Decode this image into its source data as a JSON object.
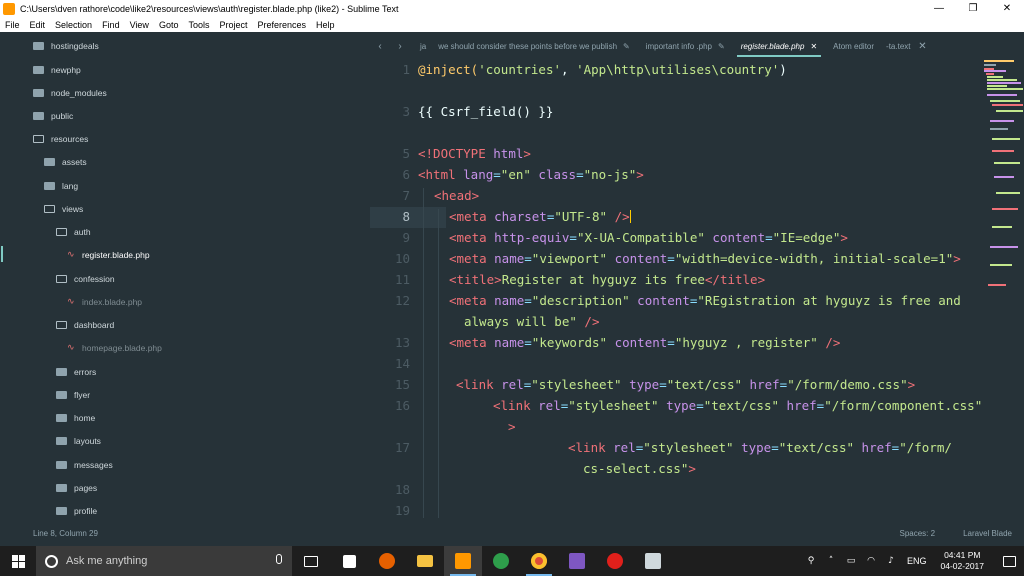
{
  "window": {
    "title": "C:\\Users\\dven rathore\\code\\like2\\resources\\views\\auth\\register.blade.php (like2) - Sublime Text",
    "minimize_label": "—",
    "maximize_label": "❐",
    "close_label": "✕"
  },
  "menu": [
    "File",
    "Edit",
    "Selection",
    "Find",
    "View",
    "Goto",
    "Tools",
    "Project",
    "Preferences",
    "Help"
  ],
  "sidebar": {
    "items": [
      {
        "label": "hostingdeals",
        "type": "folder",
        "depth": 0
      },
      {
        "label": "newphp",
        "type": "folder",
        "depth": 0
      },
      {
        "label": "node_modules",
        "type": "folder",
        "depth": 0
      },
      {
        "label": "public",
        "type": "folder",
        "depth": 0
      },
      {
        "label": "resources",
        "type": "folder-open",
        "depth": 0
      },
      {
        "label": "assets",
        "type": "folder",
        "depth": 1
      },
      {
        "label": "lang",
        "type": "folder",
        "depth": 1
      },
      {
        "label": "views",
        "type": "folder-open",
        "depth": 1
      },
      {
        "label": "auth",
        "type": "folder-open",
        "depth": 2
      },
      {
        "label": "register.blade.php",
        "type": "file-active",
        "depth": 3
      },
      {
        "label": "confession",
        "type": "folder-open",
        "depth": 2
      },
      {
        "label": "index.blade.php",
        "type": "file",
        "depth": 3
      },
      {
        "label": "dashboard",
        "type": "folder-open",
        "depth": 2
      },
      {
        "label": "homepage.blade.php",
        "type": "file",
        "depth": 3
      },
      {
        "label": "errors",
        "type": "folder",
        "depth": 2
      },
      {
        "label": "flyer",
        "type": "folder",
        "depth": 2
      },
      {
        "label": "home",
        "type": "folder",
        "depth": 2
      },
      {
        "label": "layouts",
        "type": "folder",
        "depth": 2
      },
      {
        "label": "messages",
        "type": "folder",
        "depth": 2
      },
      {
        "label": "pages",
        "type": "folder",
        "depth": 2
      },
      {
        "label": "profile",
        "type": "folder",
        "depth": 2
      }
    ]
  },
  "tabs": {
    "prev_label": "‹",
    "next_label": "›",
    "items": [
      {
        "label": "ja",
        "active": false,
        "pencil": false
      },
      {
        "label": "we should consider these points before we publish",
        "active": false,
        "pencil": true
      },
      {
        "label": "important info .php",
        "active": false,
        "pencil": true
      },
      {
        "label": "register.blade.php",
        "active": true,
        "pencil": false,
        "close": "✕"
      },
      {
        "label": "Atom editor",
        "active": false,
        "pencil": false
      },
      {
        "label": "-ta.text",
        "active": false,
        "pencil": false
      }
    ],
    "more_label": "✕"
  },
  "editor": {
    "gutter": [
      "1",
      "",
      "3",
      "",
      "5",
      "6",
      "7",
      "8",
      "9",
      "10",
      "11",
      "12",
      "",
      "13",
      "14",
      "15",
      "16",
      "",
      "17",
      "",
      "18",
      "19"
    ],
    "current_line": "8",
    "code": {
      "l1a": "@inject(",
      "l1b": "'countries'",
      "l1c": ", ",
      "l1d": "'App\\http\\utilises\\country'",
      "l1e": ")",
      "l3": "{{ Csrf_field() }}",
      "l5a": "<!DOCTYPE ",
      "l5b": "html",
      "l5c": ">",
      "l6a": "<html ",
      "l6b": "lang",
      "l6c": "=",
      "l6d": "\"en\"",
      "l6e": " class",
      "l6f": "=",
      "l6g": "\"no-js\"",
      "l6h": ">",
      "l7": "<head>",
      "l8a": "<meta ",
      "l8b": "charset",
      "l8c": "=",
      "l8d": "\"UTF-8\"",
      "l8e": " />",
      "l9a": "<meta ",
      "l9b": "http-equiv",
      "l9c": "=",
      "l9d": "\"X-UA-Compatible\"",
      "l9e": " content",
      "l9f": "=",
      "l9g": "\"IE=edge\"",
      "l9h": ">",
      "l10a": "<meta ",
      "l10b": "name",
      "l10c": "=",
      "l10d": "\"viewport\"",
      "l10e": " content",
      "l10f": "=",
      "l10g": "\"width=device-width, initial-scale=1\"",
      "l10h": ">",
      "l11a": "<title>",
      "l11b": "Register at hyguyz its free",
      "l11c": "</title>",
      "l12a": "<meta ",
      "l12b": "name",
      "l12c": "=",
      "l12d": "\"description\"",
      "l12e": " content",
      "l12f": "=",
      "l12g": "\"REgistration at hyguyz is free and",
      "l12w": "always will be\"",
      "l12x": " />",
      "l13a": "<meta ",
      "l13b": "name",
      "l13c": "=",
      "l13d": "\"keywords\"",
      "l13e": " content",
      "l13f": "=",
      "l13g": "\"hyguyz , register\"",
      "l13h": " />",
      "l15a": "<link ",
      "l15b": "rel",
      "l15c": "=",
      "l15d": "\"stylesheet\"",
      "l15e": " type",
      "l15f": "=",
      "l15g": "\"text/css\"",
      "l15h": " href",
      "l15i": "=",
      "l15j": "\"/form/demo.css\"",
      "l15k": ">",
      "l16a": "<link ",
      "l16b": "rel",
      "l16c": "=",
      "l16d": "\"stylesheet\"",
      "l16e": " type",
      "l16f": "=",
      "l16g": "\"text/css\"",
      "l16h": " href",
      "l16i": "=",
      "l16j": "\"/form/component.css\"",
      "l16w": ">",
      "l17a": "<link ",
      "l17b": "rel",
      "l17c": "=",
      "l17d": "\"stylesheet\"",
      "l17e": " type",
      "l17f": "=",
      "l17g": "\"text/css\"",
      "l17h": " href",
      "l17i": "=",
      "l17j": "\"/form/",
      "l17w": "cs-select.css\"",
      "l17x": ">"
    }
  },
  "statusbar": {
    "position": "Line 8, Column 29",
    "spaces": "Spaces: 2",
    "syntax": "Laravel Blade"
  },
  "taskbar": {
    "search_placeholder": "Ask me anything",
    "tray_lang": "ENG",
    "time": "04:41 PM",
    "date": "04-02-2017"
  },
  "colors": {
    "background": "#263238",
    "accent": "#80cbc4",
    "tag": "#f07178",
    "attribute": "#c792ea",
    "string": "#c3e88d"
  }
}
